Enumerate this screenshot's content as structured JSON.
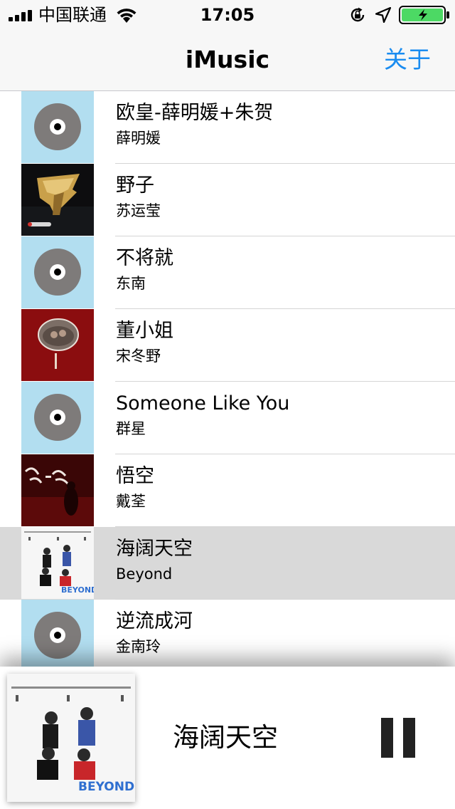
{
  "status_bar": {
    "carrier": "中国联通",
    "time": "17:05",
    "icons": [
      "signal-icon",
      "wifi-icon",
      "orientation-lock-icon",
      "location-icon",
      "battery-icon"
    ],
    "battery_color": "#4cd964"
  },
  "nav": {
    "title": "iMusic",
    "about_label": "关于",
    "accent_color": "#1a8cf0"
  },
  "songs": [
    {
      "title": "欧皇-薛明媛+朱贺",
      "artist": "薛明媛",
      "art": "placeholder"
    },
    {
      "title": "野子",
      "artist": "苏运莹",
      "art": "album"
    },
    {
      "title": "不将就",
      "artist": "东南",
      "art": "placeholder"
    },
    {
      "title": "董小姐",
      "artist": "宋冬野",
      "art": "album"
    },
    {
      "title": "Someone Like You",
      "artist": "群星",
      "art": "placeholder"
    },
    {
      "title": "悟空",
      "artist": "戴荃",
      "art": "album"
    },
    {
      "title": "海阔天空",
      "artist": "Beyond",
      "art": "album",
      "selected": true
    },
    {
      "title": "逆流成河",
      "artist": "金南玲",
      "art": "placeholder"
    }
  ],
  "now_playing": {
    "title": "海阔天空",
    "control_icon": "pause-icon"
  }
}
